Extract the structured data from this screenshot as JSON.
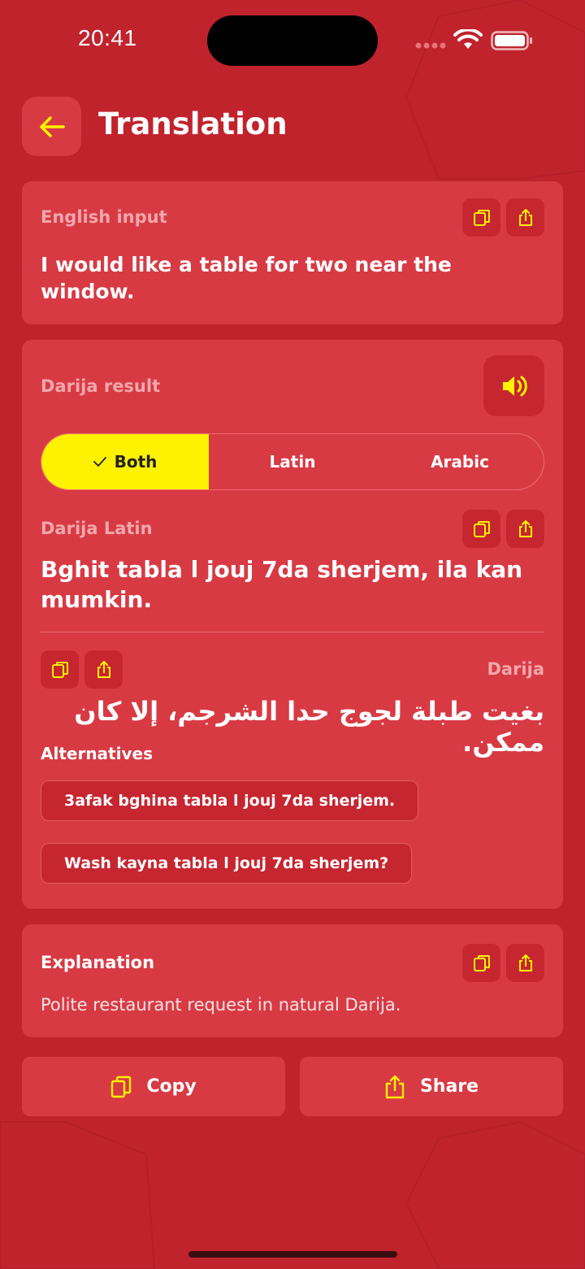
{
  "status_bar": {
    "time": "20:41"
  },
  "header": {
    "title": "Translation"
  },
  "input_card": {
    "label": "English input",
    "text": "I would like a table for two near the window."
  },
  "result_card": {
    "label": "Darija result",
    "segments": {
      "both": "Both",
      "latin": "Latin",
      "arabic": "Arabic"
    },
    "selected_segment": "Both",
    "latin_label": "Darija Latin",
    "latin_text": "Bghit tabla l jouj 7da sherjem, ila kan mumkin.",
    "arabic_label": "Darija",
    "arabic_text": "بغيت طبلة لجوج حدا الشرجم، إلا كان ممكن.",
    "alternatives_title": "Alternatives",
    "alternatives": [
      "3afak bghina tabla l jouj 7da sherjem.",
      "Wash kayna tabla l jouj 7da sherjem?"
    ]
  },
  "explanation_card": {
    "label": "Explanation",
    "text": "Polite restaurant request in natural Darija."
  },
  "actions": {
    "copy": "Copy",
    "share": "Share"
  },
  "colors": {
    "background": "#c1232d",
    "card": "#d83a44",
    "accent": "#fff200",
    "icon_button": "#c62630"
  },
  "icons": {
    "back": "arrow-left-icon",
    "copy": "copy-icon",
    "share": "share-icon",
    "speaker": "speaker-icon",
    "check": "check-icon"
  }
}
